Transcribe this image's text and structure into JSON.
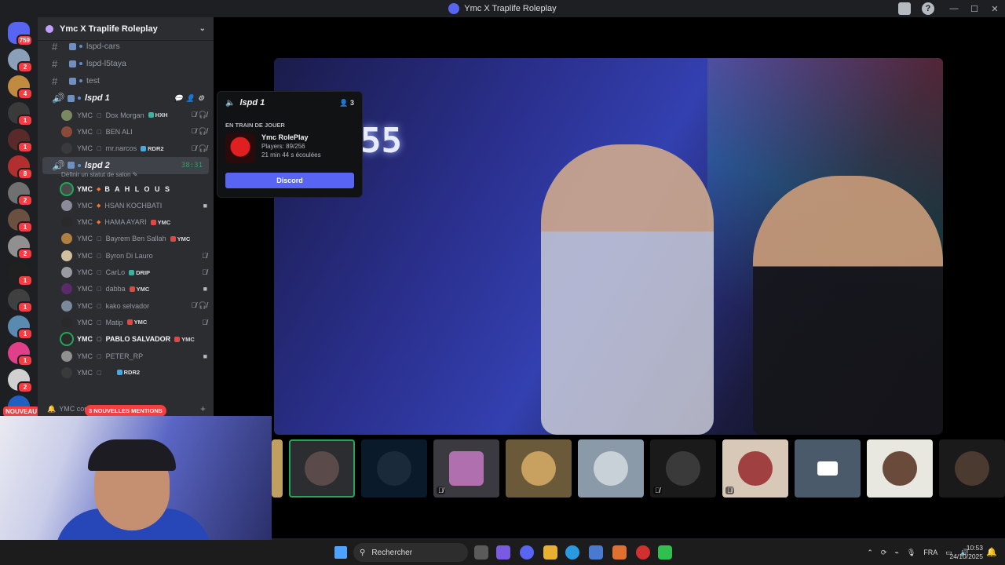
{
  "window": {
    "title": "Ymc X Traplife Roleplay",
    "controls": [
      "—",
      "☐",
      "✕"
    ]
  },
  "guilds": {
    "home_badge": "759",
    "badges": [
      "2",
      "4",
      "1",
      "1",
      "8",
      "2",
      "1",
      "2",
      "1",
      "1",
      "1",
      "1",
      "2",
      "3"
    ],
    "new_label": "NOUVEAU"
  },
  "server": {
    "name": "Ymc X Traplife Roleplay"
  },
  "channels": {
    "text": [
      "lspd-cars",
      "lspd-l5taya",
      "test"
    ],
    "voice1": {
      "name": "lspd 1",
      "users": [
        {
          "tag": "YMC",
          "name": "Dox Morgan",
          "game": "HXH"
        },
        {
          "tag": "YMC",
          "name": "BEN ALI",
          "game": ""
        },
        {
          "tag": "YMC",
          "name": "mr.narcos",
          "game": "RDR2"
        }
      ]
    },
    "voice2": {
      "name": "lspd 2",
      "timer": "38:31",
      "status": "Définir un statut de salon",
      "users": [
        {
          "tag": "YMC",
          "name": "B A H L O U S",
          "game": ""
        },
        {
          "tag": "YMC",
          "name": "HSAN KOCHBATI",
          "game": ""
        },
        {
          "tag": "YMC",
          "name": "HAMA AYARI",
          "game": "YMC"
        },
        {
          "tag": "YMC",
          "name": "Bayrem Ben Sallah",
          "game": "YMC"
        },
        {
          "tag": "YMC",
          "name": "Byron Di Lauro",
          "game": ""
        },
        {
          "tag": "YMC",
          "name": "CarLo",
          "game": "DRIP"
        },
        {
          "tag": "YMC",
          "name": "dabba",
          "game": "YMC"
        },
        {
          "tag": "YMC",
          "name": "kako selvador",
          "game": ""
        },
        {
          "tag": "YMC",
          "name": "Matip",
          "game": "YMC"
        },
        {
          "tag": "YMC",
          "name": "PABLO SALVADOR",
          "game": "YMC"
        },
        {
          "tag": "YMC",
          "name": "PETER_RP",
          "game": ""
        },
        {
          "tag": "YMC",
          "name": "",
          "game": "RDR2"
        }
      ]
    },
    "bottom_row": "YMC cor",
    "mentions": "3 NOUVELLES MENTIONS"
  },
  "popup": {
    "channel": "lspd 1",
    "count": "3",
    "playing_label": "EN TRAIN DE JOUER",
    "game_name": "Ymc RolePlay",
    "players": "Players: 89/256",
    "elapsed": "21 min 44 s écoulées",
    "button": "Discord"
  },
  "stage": {
    "sign_text": "55"
  },
  "taskbar": {
    "search_placeholder": "Rechercher",
    "lang": "FRA",
    "time": "10:53",
    "date": "24/10/2025"
  }
}
